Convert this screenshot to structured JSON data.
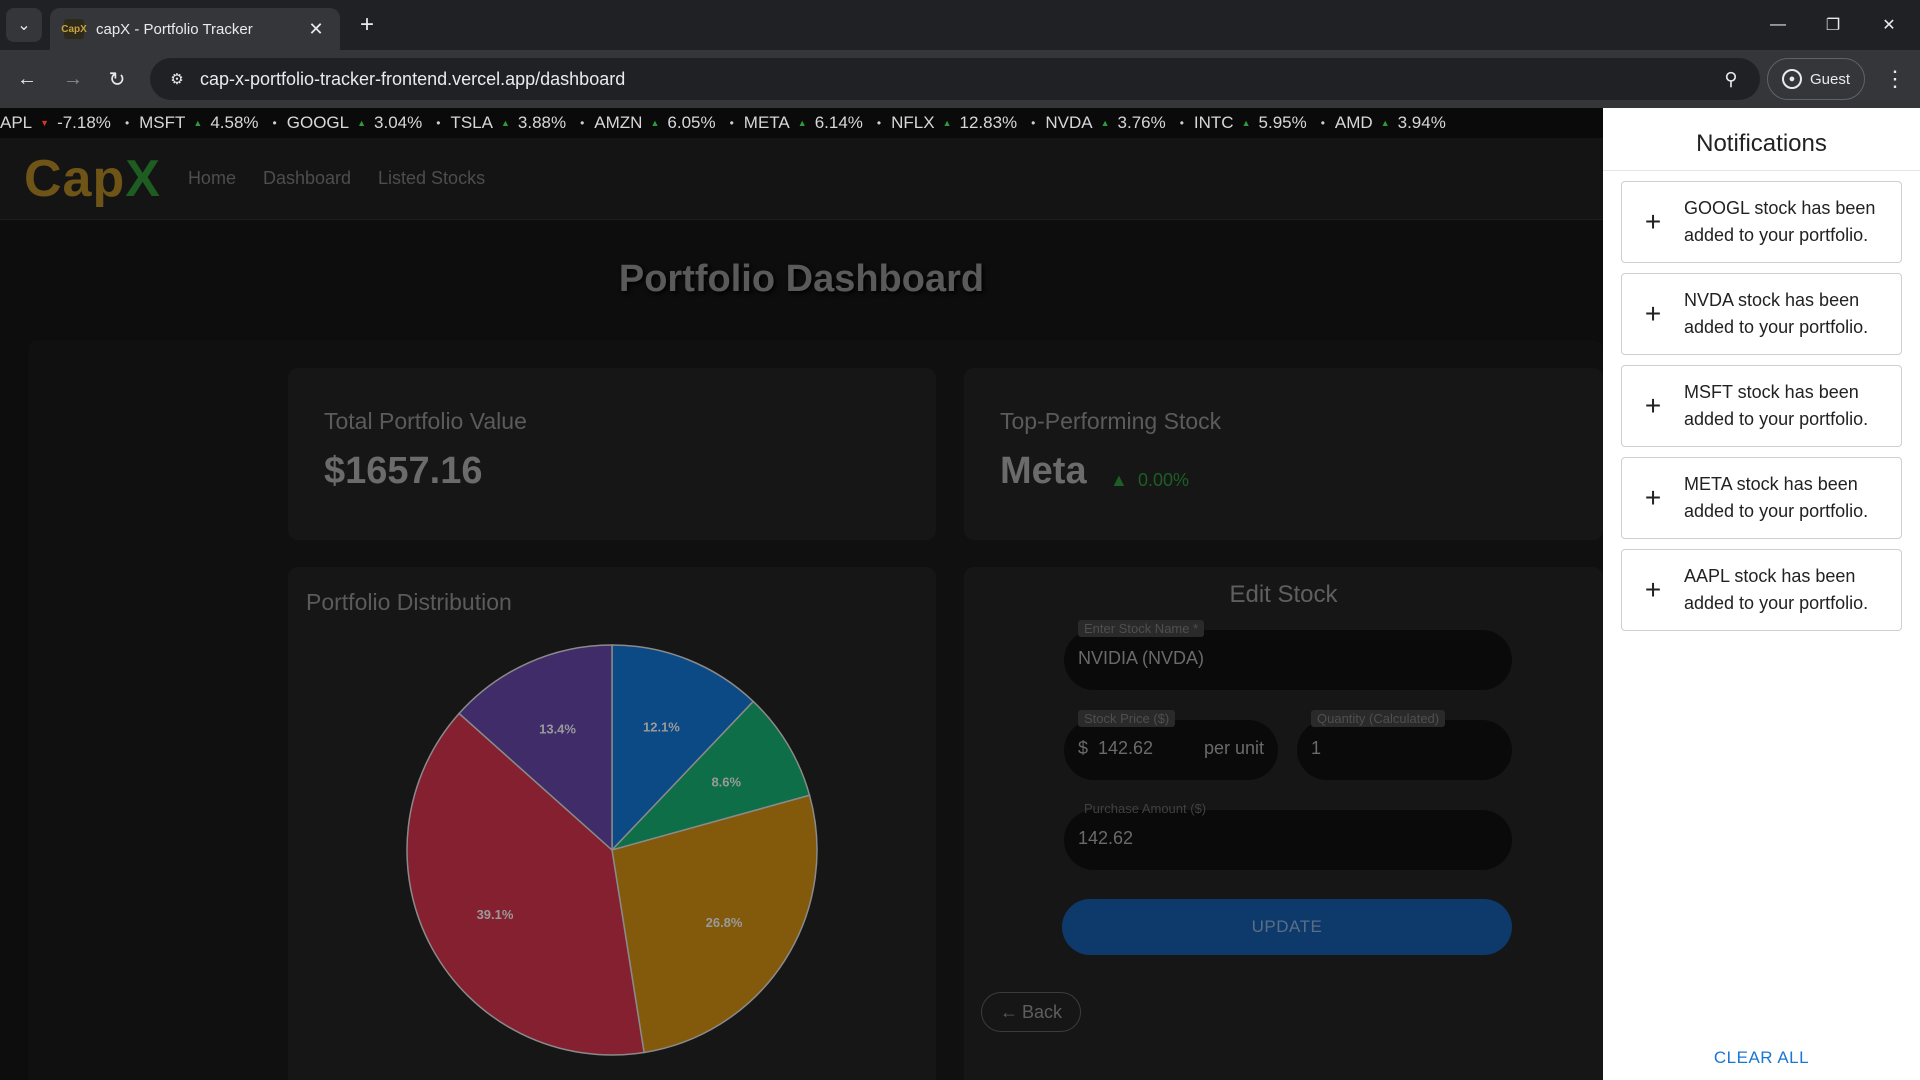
{
  "browser": {
    "tab_title": "capX - Portfolio Tracker",
    "favicon_text": "CapX",
    "url": "cap-x-portfolio-tracker-frontend.vercel.app/dashboard",
    "profile_label": "Guest"
  },
  "ticker": [
    {
      "symbol": "APL",
      "direction": "down",
      "change": "-7.18%"
    },
    {
      "symbol": "MSFT",
      "direction": "up",
      "change": "4.58%"
    },
    {
      "symbol": "GOOGL",
      "direction": "up",
      "change": "3.04%"
    },
    {
      "symbol": "TSLA",
      "direction": "up",
      "change": "3.88%"
    },
    {
      "symbol": "AMZN",
      "direction": "up",
      "change": "6.05%"
    },
    {
      "symbol": "META",
      "direction": "up",
      "change": "6.14%"
    },
    {
      "symbol": "NFLX",
      "direction": "up",
      "change": "12.83%"
    },
    {
      "symbol": "NVDA",
      "direction": "up",
      "change": "3.76%"
    },
    {
      "symbol": "INTC",
      "direction": "up",
      "change": "5.95%"
    },
    {
      "symbol": "AMD",
      "direction": "up",
      "change": "3.94%"
    }
  ],
  "nav": {
    "logo_main": "Cap",
    "logo_accent": "X",
    "links": [
      "Home",
      "Dashboard",
      "Listed Stocks"
    ]
  },
  "dashboard": {
    "title": "Portfolio Dashboard",
    "total_label": "Total Portfolio Value",
    "total_value": "$1657.16",
    "top_label": "Top-Performing Stock",
    "top_stock": "Meta",
    "top_change": "0.00%",
    "distribution_title": "Portfolio Distribution"
  },
  "chart_data": {
    "type": "pie",
    "slices": [
      {
        "label": "12.1%",
        "value": 12.1,
        "color": "#0c4a86"
      },
      {
        "label": "8.6%",
        "value": 8.6,
        "color": "#0e6e48"
      },
      {
        "label": "26.8%",
        "value": 26.8,
        "color": "#835a0c"
      },
      {
        "label": "39.1%",
        "value": 39.1,
        "color": "#842030"
      },
      {
        "label": "13.4%",
        "value": 13.4,
        "color": "#3f2c69"
      }
    ]
  },
  "edit_stock": {
    "title": "Edit Stock",
    "name_label": "Enter Stock Name *",
    "name_value": "NVIDIA (NVDA)",
    "price_label": "Stock Price ($)",
    "price_prefix": "$",
    "price_value": "142.62",
    "price_suffix": "per unit",
    "quantity_label": "Quantity (Calculated)",
    "quantity_value": "1",
    "amount_label": "Purchase Amount ($)",
    "amount_value": "142.62",
    "update_label": "UPDATE",
    "back_label": "Back"
  },
  "notifications": {
    "title": "Notifications",
    "items": [
      "GOOGL stock has been added to your portfolio.",
      "NVDA stock has been added to your portfolio.",
      "MSFT stock has been added to your portfolio.",
      "META stock has been added to your portfolio.",
      "AAPL stock has been added to your portfolio."
    ],
    "clear_label": "CLEAR ALL"
  }
}
